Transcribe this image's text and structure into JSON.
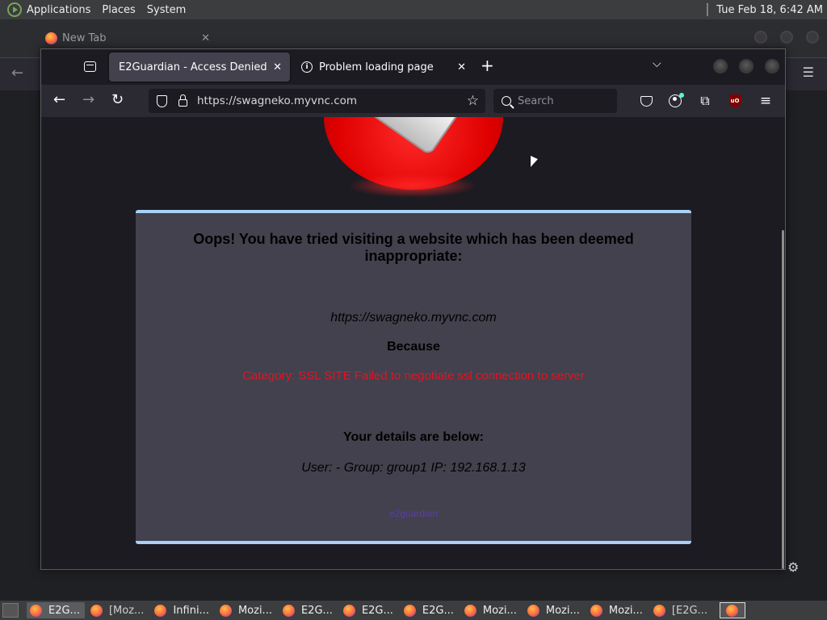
{
  "top_panel": {
    "menus": [
      "Applications",
      "Places",
      "System"
    ],
    "clock": "Tue Feb 18,  6:42 AM"
  },
  "background_window": {
    "tab_label": "New Tab",
    "tab_close": "✕"
  },
  "browser": {
    "tabs": [
      {
        "label": "E2Guardian - Access Denied",
        "active": true
      },
      {
        "label": "Problem loading page",
        "active": false
      }
    ],
    "tab_close": "✕",
    "new_tab": "+",
    "list_all_tabs": "⌄",
    "nav": {
      "back": "←",
      "forward": "→",
      "reload": "↻"
    },
    "url": "https://swagneko.myvnc.com",
    "bookmark_star": "☆",
    "search_placeholder": "Search",
    "app_menu": "≡"
  },
  "page": {
    "title": "Oops! You have tried visiting a website which has been deemed inappropriate:",
    "blocked_url": "https://swagneko.myvnc.com",
    "because_label": "Because",
    "reason": "Category: SSL SITE   Failed to negotiate ssl connection to server",
    "details_heading": "Your details are below:",
    "details": "User: -    Group: group1    IP: 192.168.1.13",
    "footer_link": "e2guardian"
  },
  "taskbar": {
    "tasks": [
      {
        "label": "E2G...",
        "active": true
      },
      {
        "label": "[Moz...",
        "active": false
      },
      {
        "label": "Infini...",
        "active": false
      },
      {
        "label": "Mozi...",
        "active": false
      },
      {
        "label": "E2G...",
        "active": false
      },
      {
        "label": "E2G...",
        "active": false
      },
      {
        "label": "E2G...",
        "active": false
      },
      {
        "label": "Mozi...",
        "active": false
      },
      {
        "label": "Mozi...",
        "active": false
      },
      {
        "label": "Mozi...",
        "active": false
      },
      {
        "label": "[E2G...",
        "active": false
      }
    ]
  },
  "colors": {
    "accent_border": "#a9d1f5",
    "reason_text": "#e81123",
    "card_bg": "#42414d"
  }
}
